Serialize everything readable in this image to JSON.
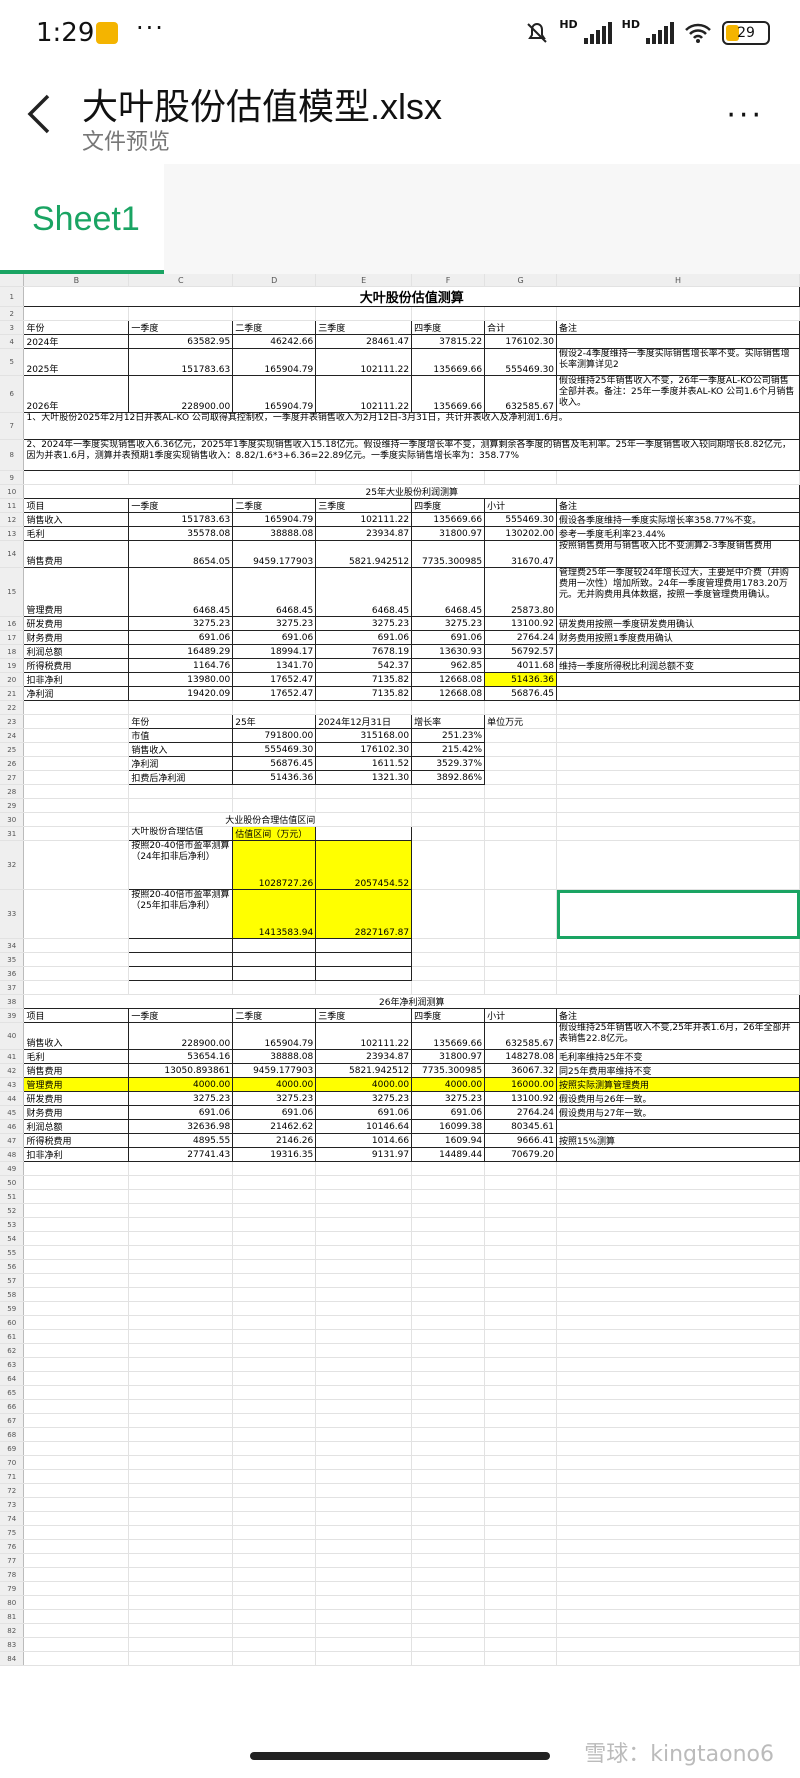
{
  "status": {
    "time": "1:29",
    "more": "···",
    "battery": "29",
    "hd1": "HD",
    "hd2": "HD"
  },
  "header": {
    "title": "大叶股份估值模型.xlsx",
    "subtitle": "文件预览",
    "more": "···"
  },
  "tabs": [
    {
      "label": "Sheet1"
    }
  ],
  "colors": {
    "accent": "#1aa463",
    "highlight": "#ffff00"
  },
  "columns": [
    "B",
    "C",
    "D",
    "E",
    "F",
    "G",
    "H"
  ],
  "rows": [
    {
      "num": "1",
      "kind": "title",
      "text": "大叶股份估值测算"
    },
    {
      "num": "2",
      "kind": "empty"
    },
    {
      "num": "3",
      "kind": "cells",
      "cells": [
        "年份",
        "一季度",
        "二季度",
        "三季度",
        "四季度",
        "合计",
        "备注"
      ],
      "bordered": true
    },
    {
      "num": "4",
      "kind": "cells",
      "cells": [
        "2024年",
        "63582.95",
        "46242.66",
        "28461.47",
        "37815.22",
        "176102.30",
        ""
      ],
      "bordered": true
    },
    {
      "num": "5",
      "kind": "cells",
      "h": 26,
      "cells": [
        "2025年",
        "151783.63",
        "165904.79",
        "102111.22",
        "135669.66",
        "555469.30",
        "假设2-4季度维持一季度实际销售增长率不变。实际销售增长率测算详见2"
      ],
      "bordered": true
    },
    {
      "num": "6",
      "kind": "cells",
      "h": 36,
      "cells": [
        "2026年",
        "228900.00",
        "165904.79",
        "102111.22",
        "135669.66",
        "632585.67",
        "假设维持25年销售收入不变，26年一季度AL-KO公司销售全部并表。备注：25年一季度并表AL-KO 公司1.6个月销售收入。"
      ],
      "bordered": true
    },
    {
      "num": "7",
      "kind": "text",
      "h": 26,
      "text": "1、大叶股份2025年2月12日并表AL-KO 公司取得其控制权，一季度并表销售收入为2月12日-3月31日，共计并表收入及净利润1.6月。"
    },
    {
      "num": "8",
      "kind": "text",
      "h": 30,
      "text": "2、2024年一季度实现销售收入6.36亿元，2025年1季度实现销售收入15.18亿元。假设维持一季度增长率不变，测算剩余各季度的销售及毛利率。25年一季度销售收入较同期增长8.82亿元，因为并表1.6月，测算并表预期1季度实现销售收入：8.82/1.6*3+6.36=22.89亿元。一季度实际销售增长率为：358.77%"
    },
    {
      "num": "9",
      "kind": "empty"
    },
    {
      "num": "10",
      "kind": "title2",
      "text": "25年大业股份利润测算"
    },
    {
      "num": "11",
      "kind": "cells",
      "cells": [
        "项目",
        "一季度",
        "二季度",
        "三季度",
        "四季度",
        "小计",
        "备注"
      ],
      "bordered": true
    },
    {
      "num": "12",
      "kind": "cells",
      "cells": [
        "销售收入",
        "151783.63",
        "165904.79",
        "102111.22",
        "135669.66",
        "555469.30",
        "假设各季度维持一季度实际增长率358.77%不变。"
      ],
      "bordered": true
    },
    {
      "num": "13",
      "kind": "cells",
      "cells": [
        "毛利",
        "35578.08",
        "38888.08",
        "23934.87",
        "31800.97",
        "130202.00",
        "参考一季度毛利率23.44%"
      ],
      "bordered": true
    },
    {
      "num": "14",
      "kind": "cells",
      "h": 26,
      "cells": [
        "销售费用",
        "8654.05",
        "9459.177903",
        "5821.942512",
        "7735.300985",
        "31670.47",
        "按照销售费用与销售收入比不变测算2-3季度销售费用"
      ],
      "bordered": true
    },
    {
      "num": "15",
      "kind": "cells",
      "h": 48,
      "cells": [
        "管理费用",
        "6468.45",
        "6468.45",
        "6468.45",
        "6468.45",
        "25873.80",
        "管理费25年一季度较24年增长过大，主要是中介费（并购费用一次性）增加所致。24年一季度管理费用1783.20万元。无并购费用具体数据，按照一季度管理费用确认。"
      ],
      "bordered": true
    },
    {
      "num": "16",
      "kind": "cells",
      "cells": [
        "研发费用",
        "3275.23",
        "3275.23",
        "3275.23",
        "3275.23",
        "13100.92",
        "研发费用按照一季度研发费用确认"
      ],
      "bordered": true
    },
    {
      "num": "17",
      "kind": "cells",
      "cells": [
        "财务费用",
        "691.06",
        "691.06",
        "691.06",
        "691.06",
        "2764.24",
        "财务费用按照1季度费用确认"
      ],
      "bordered": true
    },
    {
      "num": "18",
      "kind": "cells",
      "cells": [
        "利润总额",
        "16489.29",
        "18994.17",
        "7678.19",
        "13630.93",
        "56792.57",
        ""
      ],
      "bordered": true
    },
    {
      "num": "19",
      "kind": "cells",
      "cells": [
        "所得税费用",
        "1164.76",
        "1341.70",
        "542.37",
        "962.85",
        "4011.68",
        "维持一季度所得税比利润总额不变"
      ],
      "bordered": true
    },
    {
      "num": "20",
      "kind": "cells",
      "cells": [
        "扣非净利",
        "13980.00",
        "17652.47",
        "7135.82",
        "12668.08",
        "51436.36",
        ""
      ],
      "bordered": true,
      "yellowCol": 5
    },
    {
      "num": "21",
      "kind": "cells",
      "cells": [
        "净利润",
        "19420.09",
        "17652.47",
        "7135.82",
        "12668.08",
        "56876.45",
        ""
      ],
      "bordered": true
    },
    {
      "num": "22",
      "kind": "empty"
    },
    {
      "num": "23",
      "kind": "val",
      "cells": [
        "",
        "年份",
        "25年",
        "2024年12月31日",
        "增长率",
        "单位万元",
        ""
      ]
    },
    {
      "num": "24",
      "kind": "val",
      "cells": [
        "",
        "市值",
        "791800.00",
        "315168.00",
        "251.23%",
        "",
        ""
      ]
    },
    {
      "num": "25",
      "kind": "val",
      "cells": [
        "",
        "销售收入",
        "555469.30",
        "176102.30",
        "215.42%",
        "",
        ""
      ]
    },
    {
      "num": "26",
      "kind": "val",
      "cells": [
        "",
        "净利润",
        "56876.45",
        "1611.52",
        "3529.37%",
        "",
        ""
      ]
    },
    {
      "num": "27",
      "kind": "val",
      "cells": [
        "",
        "扣费后净利润",
        "51436.36",
        "1321.30",
        "3892.86%",
        "",
        ""
      ]
    },
    {
      "num": "28",
      "kind": "empty"
    },
    {
      "num": "29",
      "kind": "empty"
    },
    {
      "num": "30",
      "kind": "range_title",
      "text": "大业股份合理估值区间"
    },
    {
      "num": "31",
      "kind": "range",
      "cells": [
        "",
        "大叶股份合理估值",
        "估值区间（万元）",
        "",
        "",
        "",
        ""
      ]
    },
    {
      "num": "32",
      "kind": "range",
      "h": 48,
      "cells": [
        "",
        "按照20-40倍市盈率测算（24年扣非后净利）",
        "1028727.26",
        "2057454.52",
        "",
        "",
        ""
      ]
    },
    {
      "num": "33",
      "kind": "range",
      "h": 48,
      "cells": [
        "",
        "按照20-40倍市盈率测算（25年扣非后净利）",
        "1413583.94",
        "2827167.87",
        "",
        "",
        ""
      ]
    },
    {
      "num": "34",
      "kind": "range",
      "cells": [
        "",
        "",
        "",
        "",
        "",
        "",
        ""
      ]
    },
    {
      "num": "35",
      "kind": "range",
      "cells": [
        "",
        "",
        "",
        "",
        "",
        "",
        ""
      ]
    },
    {
      "num": "36",
      "kind": "range",
      "cells": [
        "",
        "",
        "",
        "",
        "",
        "",
        ""
      ]
    },
    {
      "num": "37",
      "kind": "empty"
    },
    {
      "num": "38",
      "kind": "title2",
      "text": "26年净利润测算"
    },
    {
      "num": "39",
      "kind": "cells",
      "cells": [
        "项目",
        "一季度",
        "二季度",
        "三季度",
        "四季度",
        "小计",
        "备注"
      ],
      "bordered": true
    },
    {
      "num": "40",
      "kind": "cells",
      "h": 26,
      "cells": [
        "销售收入",
        "228900.00",
        "165904.79",
        "102111.22",
        "135669.66",
        "632585.67",
        "假设维持25年销售收入不变,25年并表1.6月，26年全部并表销售22.8亿元。"
      ],
      "bordered": true
    },
    {
      "num": "41",
      "kind": "cells",
      "cells": [
        "毛利",
        "53654.16",
        "38888.08",
        "23934.87",
        "31800.97",
        "148278.08",
        "毛利率维持25年不变"
      ],
      "bordered": true
    },
    {
      "num": "42",
      "kind": "cells",
      "cells": [
        "销售费用",
        "13050.893861",
        "9459.177903",
        "5821.942512",
        "7735.300985",
        "36067.32",
        "同25年费用率维持不变"
      ],
      "bordered": true
    },
    {
      "num": "43",
      "kind": "cells",
      "cells": [
        "管理费用",
        "4000.00",
        "4000.00",
        "4000.00",
        "4000.00",
        "16000.00",
        "按照实际测算管理费用"
      ],
      "bordered": true,
      "yellowRow": true
    },
    {
      "num": "44",
      "kind": "cells",
      "cells": [
        "研发费用",
        "3275.23",
        "3275.23",
        "3275.23",
        "3275.23",
        "13100.92",
        "假设费用与26年一致。"
      ],
      "bordered": true
    },
    {
      "num": "45",
      "kind": "cells",
      "cells": [
        "财务费用",
        "691.06",
        "691.06",
        "691.06",
        "691.06",
        "2764.24",
        "假设费用与27年一致。"
      ],
      "bordered": true
    },
    {
      "num": "46",
      "kind": "cells",
      "cells": [
        "利润总额",
        "32636.98",
        "21462.62",
        "10146.64",
        "16099.38",
        "80345.61",
        ""
      ],
      "bordered": true
    },
    {
      "num": "47",
      "kind": "cells",
      "cells": [
        "所得税费用",
        "4895.55",
        "2146.26",
        "1014.66",
        "1609.94",
        "9666.41",
        "按照15%测算"
      ],
      "bordered": true
    },
    {
      "num": "48",
      "kind": "cells",
      "cells": [
        "扣非净利",
        "27741.43",
        "19316.35",
        "9131.97",
        "14489.44",
        "70679.20",
        ""
      ],
      "bordered": true
    }
  ],
  "blank_rows": [
    "49",
    "50",
    "51",
    "52",
    "53",
    "54",
    "55",
    "56",
    "57",
    "58",
    "59",
    "60",
    "61",
    "62",
    "63",
    "64",
    "65",
    "66",
    "67",
    "68",
    "69",
    "70",
    "71",
    "72",
    "73",
    "74",
    "75",
    "76",
    "77",
    "78",
    "79",
    "80",
    "81",
    "82",
    "83",
    "84"
  ],
  "watermark": "雪球：kingtaono6"
}
